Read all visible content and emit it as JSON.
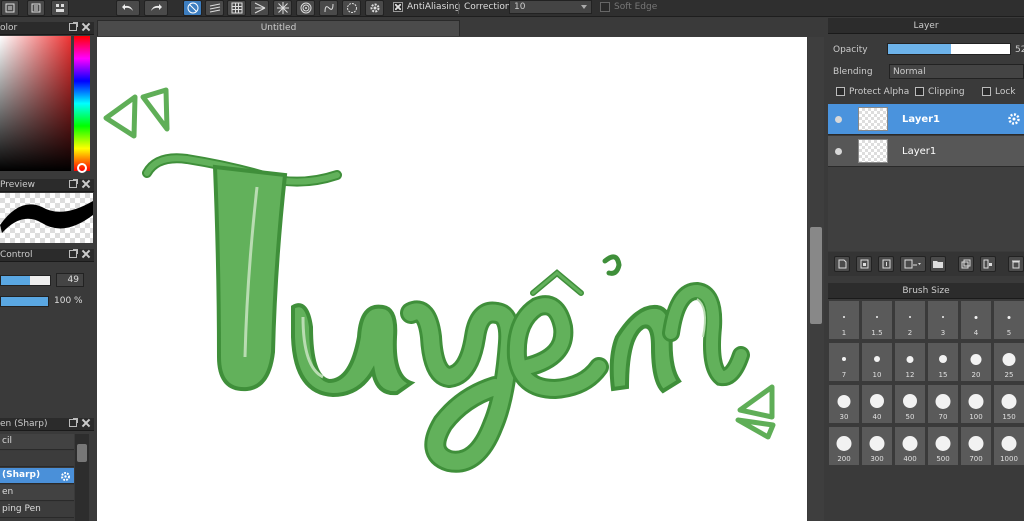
{
  "toolbar": {
    "antialiasing_label": "AntiAliasing",
    "correction_label": "Correction",
    "correction_value": "10",
    "soft_edge_label": "Soft Edge"
  },
  "left_panels": {
    "color_title": "olor",
    "preview_title": "Preview",
    "control_title": "Control",
    "size_value": "49",
    "size_fraction": 0.6,
    "opacity_value": "100 %",
    "opacity_fraction": 1.0,
    "brush_list_title": "en (Sharp)",
    "brushes": [
      {
        "label": "cil",
        "selected": false
      },
      {
        "label": "",
        "selected": false
      },
      {
        "label": "(Sharp)",
        "selected": true
      },
      {
        "label": "en",
        "selected": false
      },
      {
        "label": "ping Pen",
        "selected": false
      }
    ]
  },
  "canvas": {
    "tab_title": "Untitled",
    "lettering": "Tuyển"
  },
  "layer_panel": {
    "title": "Layer",
    "opacity_label": "Opacity",
    "opacity_value": "52",
    "opacity_fraction": 0.52,
    "blending_label": "Blending",
    "blending_value": "Normal",
    "protect_alpha_label": "Protect Alpha",
    "clipping_label": "Clipping",
    "lock_label": "Lock",
    "layers": [
      {
        "name": "Layer1",
        "selected": true
      },
      {
        "name": "Layer1",
        "selected": false
      }
    ]
  },
  "brush_size_panel": {
    "title": "Brush Size",
    "sizes": [
      "1",
      "1.5",
      "2",
      "3",
      "4",
      "5",
      "7",
      "10",
      "12",
      "15",
      "20",
      "25",
      "30",
      "40",
      "50",
      "70",
      "100",
      "150",
      "200",
      "300",
      "400",
      "500",
      "700",
      "1000"
    ]
  },
  "colors": {
    "accent": "#4a93dd",
    "lettering_green": "#62b15b",
    "lettering_dark": "#3f8f3a",
    "lettering_light": "#b9dcb2"
  }
}
